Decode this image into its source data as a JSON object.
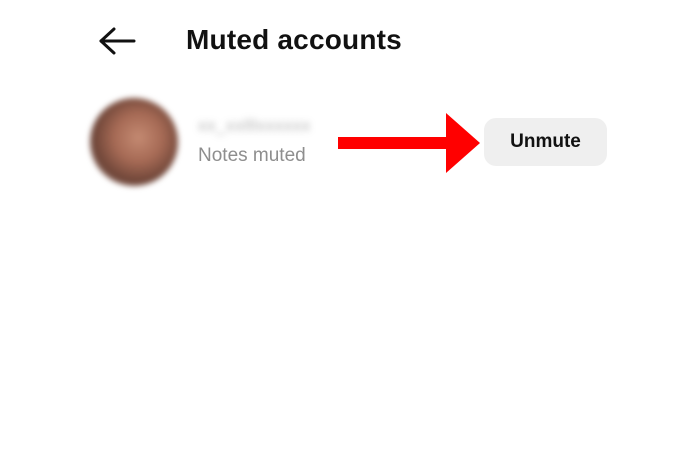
{
  "header": {
    "back_icon": "arrow-left-icon",
    "title": "Muted accounts"
  },
  "muted_list": [
    {
      "username": "xx_xxlllxxxxxx",
      "status": "Notes muted",
      "action_label": "Unmute"
    }
  ],
  "annotation": {
    "arrow_color": "#ff0000"
  }
}
